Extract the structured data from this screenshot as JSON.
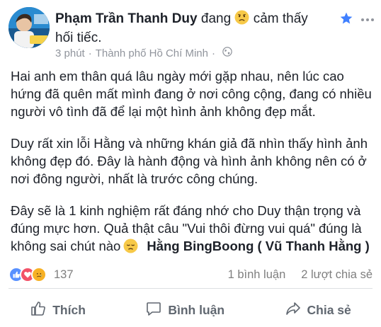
{
  "post": {
    "author": "Phạm Trần Thanh Duy",
    "feeling_prefix": "đang",
    "feeling_text": "cảm thấy hối tiếc.",
    "timestamp": "3 phút",
    "location": "Thành phố Hồ Chí Minh",
    "separator": "·",
    "paragraphs": [
      "Hai anh em thân quá lâu ngày mới gặp nhau, nên lúc cao hứng đã quên mất mình đang ở nơi công cộng, đang có nhiều người vô tình đã để lại một hình ảnh không đẹp mắt.",
      "Duy rất xin lỗi Hằng và những khán giả đã nhìn thấy hình ảnh không đẹp đó. Đây là hành động và hình ảnh không nên có ở nơi đông người, nhất là trước công chúng.",
      "Đây sẽ là 1 kinh nghiệm rất đáng nhớ cho Duy thận trọng và đúng mực hơn. Quả thật câu \"Vui thôi đừng vui quá\" đúng là không sai chút nào"
    ],
    "mention": "Hằng BingBoong ( Vũ Thanh Hằng )"
  },
  "reactions": {
    "count": "137",
    "comments": "1 bình luận",
    "shares": "2 lượt chia sẻ",
    "icons": [
      "like-icon",
      "love-icon",
      "sad-icon"
    ]
  },
  "actions": {
    "like_label": "Thích",
    "comment_label": "Bình luận",
    "share_label": "Chia sẻ"
  },
  "colors": {
    "accent": "#4080ff",
    "text": "#1d2129",
    "muted": "#90949c",
    "action": "#606770",
    "like": "#5890ff",
    "love": "#f25268",
    "sad": "#f7b125"
  }
}
